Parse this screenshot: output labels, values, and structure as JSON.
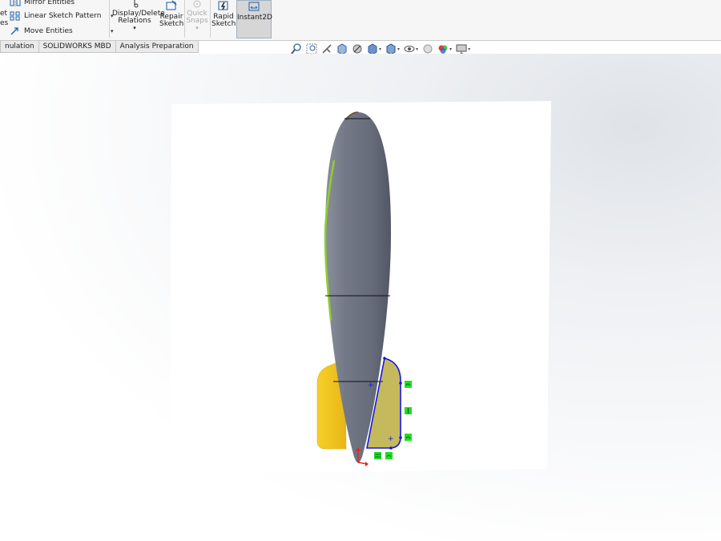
{
  "ribbon": {
    "left_cut_1": "et",
    "left_cut_2": "es",
    "mirror": "Mirror Entities",
    "linear_pattern": "Linear Sketch Pattern",
    "move": "Move Entities",
    "display_delete": "Display/Delete",
    "relations": "Relations",
    "repair": "Repair",
    "repair_sketch": "Sketch",
    "quick": "Quick",
    "snaps": "Snaps",
    "rapid": "Rapid",
    "rapid_sketch": "Sketch",
    "instant2d": "Instant2D"
  },
  "tabs": [
    {
      "label": "nulation"
    },
    {
      "label": "SOLIDWORKS MBD"
    },
    {
      "label": "Analysis Preparation"
    }
  ],
  "view_toolbar": [
    "zoom-to-fit-icon",
    "zoom-to-area-icon",
    "previous-view-icon",
    "section-view-icon",
    "dynamic-annotation-icon",
    "view-orientation-icon",
    "display-style-icon",
    "hide-show-items-icon",
    "edit-appearance-icon",
    "apply-scene-icon",
    "view-settings-icon"
  ],
  "colors": {
    "body": "#6b7080",
    "fin": "#f2c21e",
    "sketch": "#1515e6",
    "relation_badge": "#22dd22",
    "ribbon_bg": "#f6f6f6",
    "accent_highlight": "#d6d6d6"
  }
}
